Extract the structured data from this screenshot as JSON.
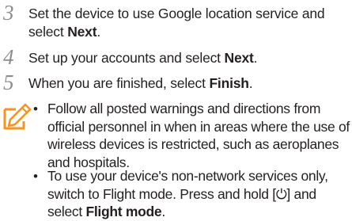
{
  "steps": [
    {
      "number": "3",
      "text": "Set the device to use Google location service and select ",
      "bold": "Next",
      "after": "."
    },
    {
      "number": "4",
      "text": "Set up your accounts and select ",
      "bold": "Next",
      "after": "."
    },
    {
      "number": "5",
      "text": "When you are finished, select ",
      "bold": "Finish",
      "after": "."
    }
  ],
  "note_icon": "note-pencil-icon",
  "notes": [
    {
      "bullet": "•",
      "text": "Follow all posted warnings and directions from official personnel in when in areas where the use of wireless devices is restricted, such as aeroplanes and hospitals."
    },
    {
      "bullet": "•",
      "text_before": "To use your device's non-network services only, switch to Flight mode. Press and hold [",
      "power_icon": "⏻",
      "text_middle": "] and select ",
      "bold": "Flight mode",
      "after": "."
    }
  ],
  "colors": {
    "text": "#231f20",
    "step_number": "#8c8c8c",
    "note_icon": "#f7941d"
  }
}
